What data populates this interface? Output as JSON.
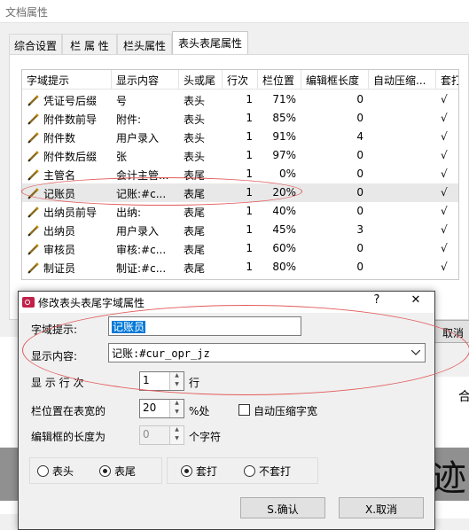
{
  "window": {
    "title": "文档属性"
  },
  "tabs": [
    {
      "label": "综合设置"
    },
    {
      "label": "栏 属 性"
    },
    {
      "label": "栏头属性"
    },
    {
      "label": "表头表尾属性"
    }
  ],
  "table": {
    "headers": [
      "字域提示",
      "显示内容",
      "头或尾",
      "行次",
      "栏位置",
      "编辑框长度",
      "自动压缩...",
      "套打"
    ],
    "rows": [
      {
        "prompt": "凭证号后缀",
        "content": "号",
        "pos": "表头",
        "line": "1",
        "col": "71%",
        "len": "0",
        "auto": "",
        "print": "√"
      },
      {
        "prompt": "附件数前导",
        "content": "附件:",
        "pos": "表头",
        "line": "1",
        "col": "85%",
        "len": "0",
        "auto": "",
        "print": "√"
      },
      {
        "prompt": "附件数",
        "content": "用户录入",
        "pos": "表头",
        "line": "1",
        "col": "91%",
        "len": "4",
        "auto": "",
        "print": "√"
      },
      {
        "prompt": "附件数后缀",
        "content": "张",
        "pos": "表头",
        "line": "1",
        "col": "97%",
        "len": "0",
        "auto": "",
        "print": "√"
      },
      {
        "prompt": "主管名",
        "content": "会计主管...",
        "pos": "表尾",
        "line": "1",
        "col": "0%",
        "len": "0",
        "auto": "",
        "print": "√"
      },
      {
        "prompt": "记账员",
        "content": "记账:#c...",
        "pos": "表尾",
        "line": "1",
        "col": "20%",
        "len": "0",
        "auto": "",
        "print": "√"
      },
      {
        "prompt": "出纳员前导",
        "content": "出纳:",
        "pos": "表尾",
        "line": "1",
        "col": "40%",
        "len": "0",
        "auto": "",
        "print": "√"
      },
      {
        "prompt": "出纳员",
        "content": "用户录入",
        "pos": "表尾",
        "line": "1",
        "col": "45%",
        "len": "3",
        "auto": "",
        "print": "√"
      },
      {
        "prompt": "审核员",
        "content": "审核:#c...",
        "pos": "表尾",
        "line": "1",
        "col": "60%",
        "len": "0",
        "auto": "",
        "print": "√"
      },
      {
        "prompt": "制证员",
        "content": "制证:#c...",
        "pos": "表尾",
        "line": "1",
        "col": "80%",
        "len": "0",
        "auto": "",
        "print": "√"
      }
    ]
  },
  "outer": {
    "cancel_label": "取消",
    "he_char": "合",
    "deco_char": "迹"
  },
  "dialog": {
    "title": "修改表头表尾字域属性",
    "help": "?",
    "close": "✕",
    "field_prompt_label": "字域提示:",
    "field_prompt_value": "记账员",
    "content_label": "显示内容:",
    "content_value": "记账:#cur_opr_jz",
    "line_label": "显  示  行  次",
    "line_value": "1",
    "line_suffix": "行",
    "col_label": "栏位置在表宽的",
    "col_value": "20",
    "col_suffix": "%处",
    "auto_compress_label": "自动压缩字宽",
    "editlen_label": "编辑框的长度为",
    "editlen_value": "0",
    "editlen_suffix": "个字符",
    "radio_head": "表头",
    "radio_tail": "表尾",
    "radio_print": "套打",
    "radio_noprint": "不套打",
    "ok_label": "S.确认",
    "cancel_label": "X.取消"
  }
}
